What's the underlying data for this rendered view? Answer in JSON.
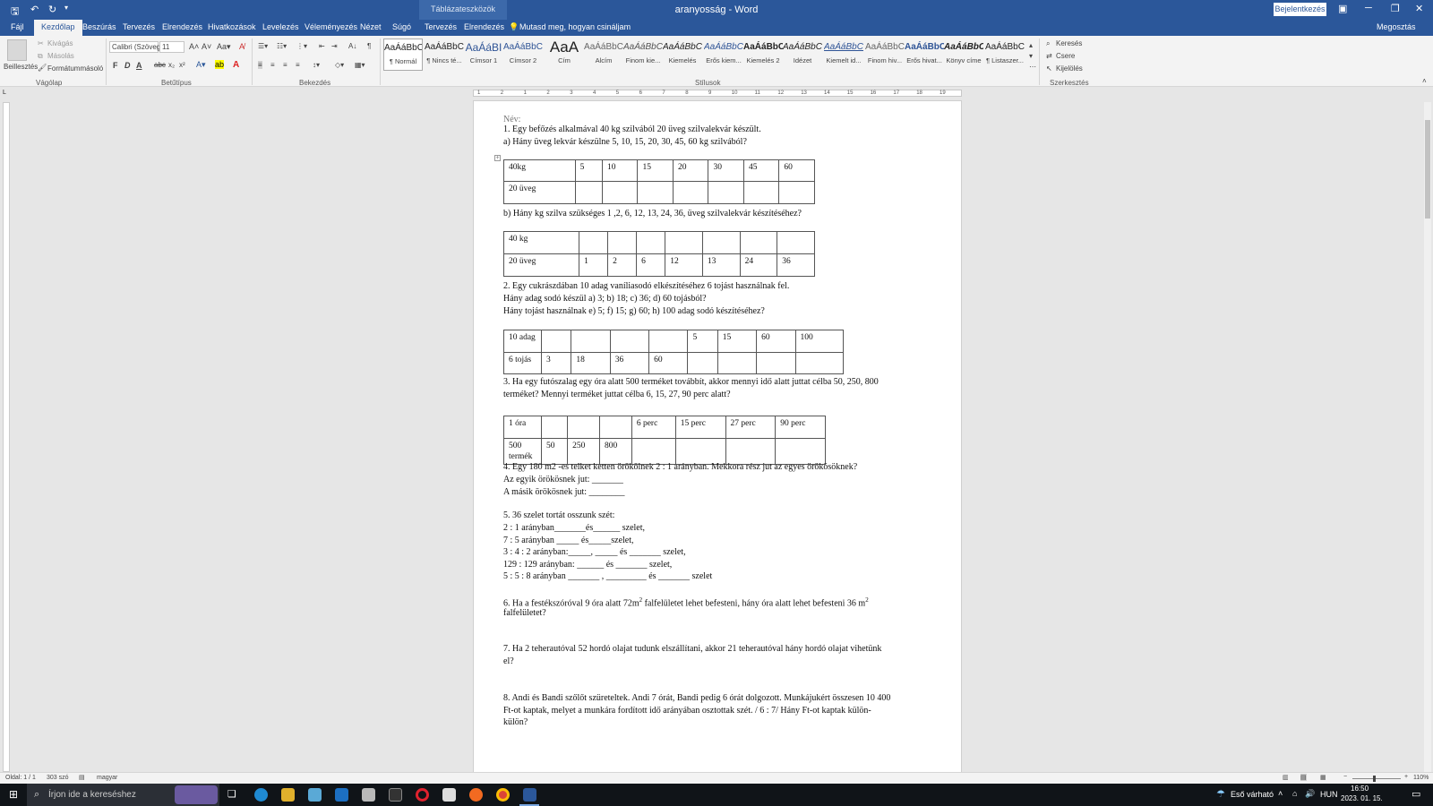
{
  "window": {
    "title": "aranyosság  -  Word",
    "context_label": "Táblázateszközök",
    "signin": "Bejelentkezés"
  },
  "tabs": [
    "Fájl",
    "Kezdőlap",
    "Beszúrás",
    "Tervezés",
    "Elrendezés",
    "Hivatkozások",
    "Levelezés",
    "Véleményezés",
    "Nézet",
    "Súgó",
    "Tervezés",
    "Elrendezés"
  ],
  "tell_me": "Mutasd meg, hogyan csináljam",
  "share": "Megosztás",
  "ribbon": {
    "clipboard": {
      "paste": "Beillesztés",
      "cut": "Kivágás",
      "copy": "Másolás",
      "format_painter": "Formátummásoló",
      "group": "Vágólap"
    },
    "font": {
      "name": "Calibri (Szöveg",
      "size": "11",
      "group": "Betűtípus"
    },
    "paragraph": {
      "group": "Bekezdés"
    },
    "styles": {
      "group": "Stílusok",
      "items": [
        {
          "preview": "AaÁáBbCcI",
          "name": "¶ Normál"
        },
        {
          "preview": "AaÁáBbCcI",
          "name": "¶ Nincs té..."
        },
        {
          "preview": "AaÁáBI",
          "name": "Címsor 1"
        },
        {
          "preview": "AaÁáBbCc",
          "name": "Címsor 2"
        },
        {
          "preview": "AaA",
          "name": "Cím"
        },
        {
          "preview": "AaÁáBbC",
          "name": "Alcím"
        },
        {
          "preview": "AaÁáBbCc",
          "name": "Finom kie..."
        },
        {
          "preview": "AaÁáBbCc",
          "name": "Kiemelés"
        },
        {
          "preview": "AaÁáBbCc",
          "name": "Erős kiem..."
        },
        {
          "preview": "AaÁáBbCc",
          "name": "Kiemelés 2"
        },
        {
          "preview": "AaÁáBbCc",
          "name": "Idézet"
        },
        {
          "preview": "AaÁáBbCc",
          "name": "Kiemelt id..."
        },
        {
          "preview": "AaÁáBbCc",
          "name": "Finom hiv..."
        },
        {
          "preview": "AaÁáBbCc",
          "name": "Erős hivat..."
        },
        {
          "preview": "AaÁáBbCc",
          "name": "Könyv címe"
        },
        {
          "preview": "AaÁáBbCc",
          "name": "¶ Listaszer..."
        }
      ]
    },
    "editing": {
      "group": "Szerkesztés",
      "find": "Keresés",
      "replace": "Csere",
      "select": "Kijelölés"
    }
  },
  "ruler_ticks": [
    "1",
    "2",
    "1",
    "2",
    "3",
    "4",
    "5",
    "6",
    "7",
    "8",
    "9",
    "10",
    "11",
    "12",
    "13",
    "14",
    "15",
    "16",
    "17",
    "18",
    "19"
  ],
  "doc": {
    "name_label": "Név:",
    "q1": "1. Egy befőzés alkalmával 40 kg szilvából 20 üveg szilvalekvár készült.",
    "q1a": "a) Hány üveg lekvár készülne 5, 10, 15, 20, 30, 45,  60 kg szilvából?",
    "t1": [
      [
        "40kg",
        "5",
        "10",
        "15",
        "20",
        "30",
        "45",
        "60"
      ],
      [
        "20 üveg",
        "",
        "",
        "",
        "",
        "",
        "",
        ""
      ]
    ],
    "q1b": "b) Hány kg szilva szükséges 1 ,2,  6, 12, 13, 24, 36,  üveg szilvalekvár készítéséhez?",
    "t2": [
      [
        "40 kg",
        "",
        "",
        "",
        "",
        "",
        "",
        ""
      ],
      [
        "20 üveg",
        "1",
        "2",
        "6",
        "12",
        "13",
        "24",
        "36"
      ]
    ],
    "q2a": "2. Egy cukrászdában 10 adag vaníliasodó elkészítéséhez 6 tojást használnak fel.",
    "q2b": "Hány adag sodó készül a) 3; b) 18; c) 36; d) 60 tojásból?",
    "q2c": "Hány tojást használnak e) 5; f) 15; g) 60; h) 100 adag sodó készítéséhez?",
    "t3": [
      [
        "10 adag",
        "",
        "",
        "",
        "",
        "5",
        "15",
        "60",
        "100"
      ],
      [
        "6 tojás",
        "3",
        "18",
        "36",
        "60",
        "",
        "",
        "",
        ""
      ]
    ],
    "q3a": "3. Ha egy futószalag egy óra alatt 500 terméket továbbít, akkor mennyi idő alatt juttat célba 50, 250, 800",
    "q3b": "terméket? Mennyi terméket juttat célba 6, 15, 27, 90 perc alatt?",
    "t4": [
      [
        "1 óra",
        "",
        "",
        "",
        "6 perc",
        "15 perc",
        "27 perc",
        "90 perc"
      ],
      [
        "500 termék",
        "50",
        "250",
        "800",
        "",
        "",
        "",
        ""
      ]
    ],
    "q4": "4. Egy 180 m2 -es telket ketten örökölnek 2 : 1 arányban. Mekkora rész jut az egyes örökösöknek?",
    "q4a": "Az egyik örökösnek jut: _______",
    "q4b": "A másik örökösnek jut: ________",
    "q5": "5.        36 szelet tortát osszunk szét:",
    "q5a": "2 : 1 arányban_______és______ szelet,",
    "q5b": "7 : 5 arányban _____ és_____szelet,",
    "q5c": "3 : 4 : 2 arányban:_____, _____ és _______ szelet,",
    "q5d": "129 : 129 arányban: ______ és _______ szelet,",
    "q5e": "5 : 5 : 8 arányban _______ , _________ és _______ szelet",
    "q6a": "6. Ha a festékszóróval 9 óra alatt 72m",
    "q6sup": "2",
    "q6b": " falfelületet lehet befesteni, hány óra alatt lehet befesteni 36 m",
    "q6c": "falfelületet?",
    "q7a": "7. Ha 2 teherautóval 52 hordó olajat tudunk elszállítani, akkor 21 teherautóval hány hordó olajat vihetünk",
    "q7b": "el?",
    "q8a": "8. Andi és Bandi szőlőt szüreteltek. Andi 7 órát, Bandi pedig 6 órát dolgozott. Munkájukért összesen 10 400",
    "q8b": "Ft-ot kaptak, melyet a munkára fordított idő arányában osztottak szét. / 6 : 7/ Hány Ft-ot kaptak külön-",
    "q8c": "külön?"
  },
  "status": {
    "page": "Oldal: 1 / 1",
    "words": "303 szó",
    "lang": "magyar",
    "zoom": "110%"
  },
  "taskbar": {
    "search": "Írjon ide a kereséshez",
    "weather": "Eső várható",
    "lang": "HUN",
    "time": "16:50",
    "date": "2023. 01. 15."
  }
}
